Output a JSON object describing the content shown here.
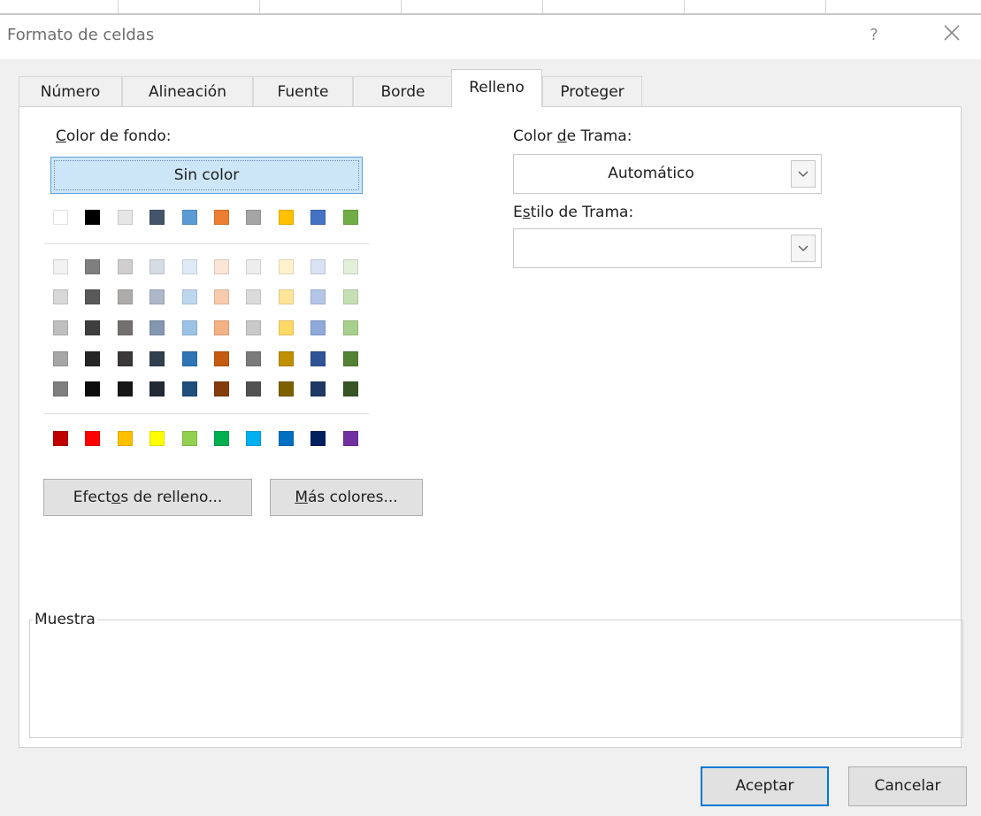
{
  "dialog": {
    "title": "Formato de celdas",
    "help_label": "?",
    "close_label": "✕"
  },
  "tabs": [
    {
      "label": "Número",
      "active": false
    },
    {
      "label": "Alineación",
      "active": false
    },
    {
      "label": "Fuente",
      "active": false
    },
    {
      "label": "Borde",
      "active": false
    },
    {
      "label": "Relleno",
      "active": true
    },
    {
      "label": "Proteger",
      "active": false
    }
  ],
  "fill": {
    "background_label_accel": "C",
    "background_label_rest": "olor de fondo:",
    "no_color_label": "Sin color",
    "theme_base": [
      "#ffffff",
      "#000000",
      "#e7e6e6",
      "#44546a",
      "#5b9bd5",
      "#ed7d31",
      "#a5a5a5",
      "#ffc000",
      "#4472c4",
      "#70ad47"
    ],
    "theme_tints": [
      [
        "#f2f2f2",
        "#7f7f7f",
        "#d0cece",
        "#d6dce4",
        "#deebf6",
        "#fbe5d5",
        "#ededed",
        "#fff2cc",
        "#d9e2f3",
        "#e2efd9"
      ],
      [
        "#d8d8d8",
        "#595959",
        "#aeabab",
        "#adb9ca",
        "#bdd7ee",
        "#f7cbac",
        "#dbdbdb",
        "#fee599",
        "#b4c6e7",
        "#c5e0b3"
      ],
      [
        "#bfbfbf",
        "#3f3f3f",
        "#757070",
        "#8496b0",
        "#9cc3e5",
        "#f4b183",
        "#c9c9c9",
        "#ffd965",
        "#8eaadb",
        "#a8d08d"
      ],
      [
        "#a5a5a5",
        "#262626",
        "#3a3838",
        "#323f4f",
        "#2e75b5",
        "#c55a11",
        "#7b7b7b",
        "#bf9000",
        "#2f5496",
        "#538135"
      ],
      [
        "#7f7f7f",
        "#0c0c0c",
        "#171616",
        "#222a35",
        "#1e4e79",
        "#833c0b",
        "#525252",
        "#7f6000",
        "#1f3864",
        "#375623"
      ]
    ],
    "standard_colors": [
      "#c00000",
      "#ff0000",
      "#ffc000",
      "#ffff00",
      "#92d050",
      "#00b050",
      "#00b0f0",
      "#0070c0",
      "#002060",
      "#7030a0"
    ],
    "fill_effects_pre": "Efect",
    "fill_effects_accel": "o",
    "fill_effects_post": "s de relleno...",
    "more_colors_accel": "M",
    "more_colors_post": "ás colores..."
  },
  "pattern": {
    "color_label_pre": "Color ",
    "color_label_accel": "d",
    "color_label_post": "e Trama:",
    "color_value": "Automático",
    "style_label_pre": "E",
    "style_label_accel": "s",
    "style_label_post": "tilo de Trama:",
    "style_value": ""
  },
  "sample": {
    "legend": "Muestra"
  },
  "footer": {
    "ok_label": "Aceptar",
    "cancel_label": "Cancelar"
  }
}
